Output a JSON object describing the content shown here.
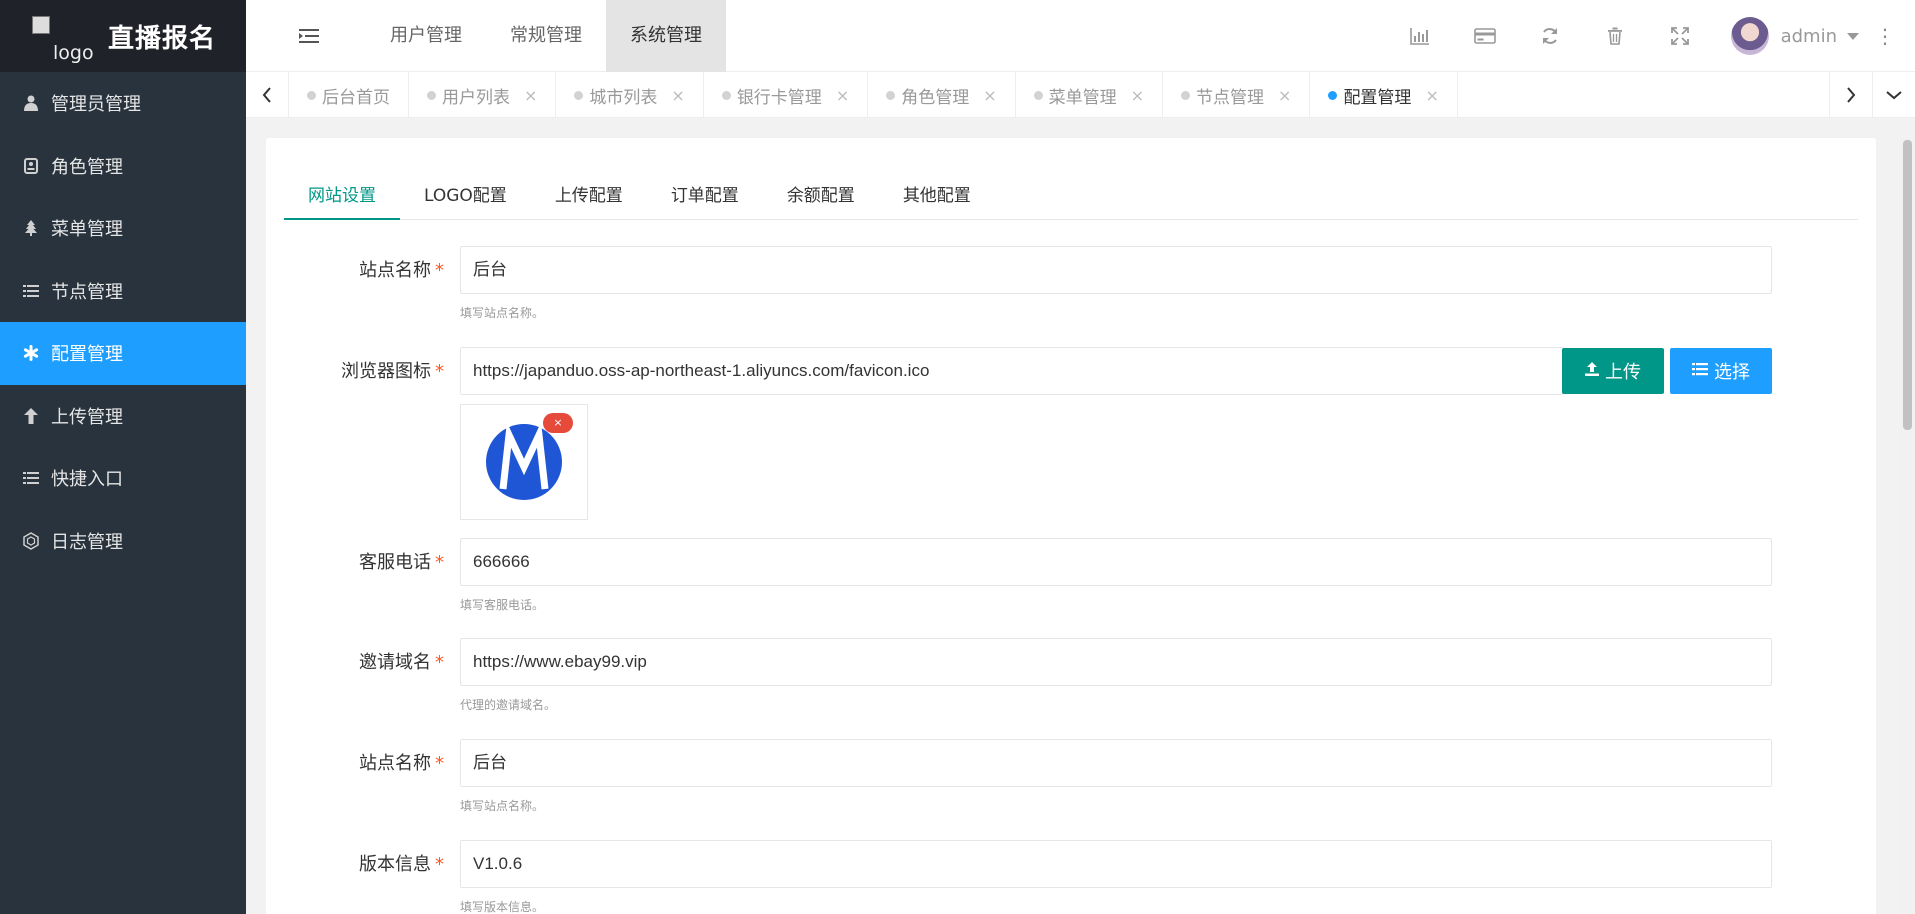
{
  "app": {
    "logo_alt": "logo",
    "title": "直播报名"
  },
  "sidebar": {
    "items": [
      {
        "label": "管理员管理",
        "icon": "user-icon"
      },
      {
        "label": "角色管理",
        "icon": "role-icon"
      },
      {
        "label": "菜单管理",
        "icon": "tree-icon"
      },
      {
        "label": "节点管理",
        "icon": "list-icon"
      },
      {
        "label": "配置管理",
        "icon": "gear-icon",
        "active": true
      },
      {
        "label": "上传管理",
        "icon": "arrow-up-icon"
      },
      {
        "label": "快捷入口",
        "icon": "list-icon"
      },
      {
        "label": "日志管理",
        "icon": "hexagon-icon"
      }
    ],
    "bg_color": "#28333e",
    "active_color": "#1e9fff"
  },
  "header": {
    "nav": [
      "用户管理",
      "常规管理",
      "系统管理"
    ],
    "active_nav": "系统管理",
    "icons": [
      "chart-icon",
      "card-icon",
      "refresh-icon",
      "trash-icon",
      "fullscreen-icon"
    ],
    "user": "admin"
  },
  "tabs": {
    "items": [
      {
        "label": "后台首页",
        "closable": false
      },
      {
        "label": "用户列表",
        "closable": true
      },
      {
        "label": "城市列表",
        "closable": true
      },
      {
        "label": "银行卡管理",
        "closable": true
      },
      {
        "label": "角色管理",
        "closable": true
      },
      {
        "label": "菜单管理",
        "closable": true
      },
      {
        "label": "节点管理",
        "closable": true
      },
      {
        "label": "配置管理",
        "closable": true,
        "active": true
      }
    ],
    "close_glyph": "×"
  },
  "config_tabs": [
    "网站设置",
    "LOGO配置",
    "上传配置",
    "订单配置",
    "余额配置",
    "其他配置"
  ],
  "form": {
    "site_name": {
      "label": "站点名称",
      "value": "后台",
      "help": "填写站点名称。"
    },
    "favicon": {
      "label": "浏览器图标",
      "value": "https://japanduo.oss-ap-northeast-1.aliyuncs.com/favicon.ico",
      "upload_label": "上传",
      "select_label": "选择",
      "remove_glyph": "×"
    },
    "service_phone": {
      "label": "客服电话",
      "value": "666666",
      "help": "填写客服电话。"
    },
    "invite_domain": {
      "label": "邀请域名",
      "value": "https://www.ebay99.vip",
      "help": "代理的邀请域名。"
    },
    "site_name_2": {
      "label": "站点名称",
      "value": "后台",
      "help": "填写站点名称。"
    },
    "version": {
      "label": "版本信息",
      "value": "V1.0.6",
      "help": "填写版本信息。"
    },
    "required_mark": "*"
  },
  "colors": {
    "primary_green": "#009688",
    "primary_blue": "#1e9fff",
    "required_red": "#ff5722"
  }
}
